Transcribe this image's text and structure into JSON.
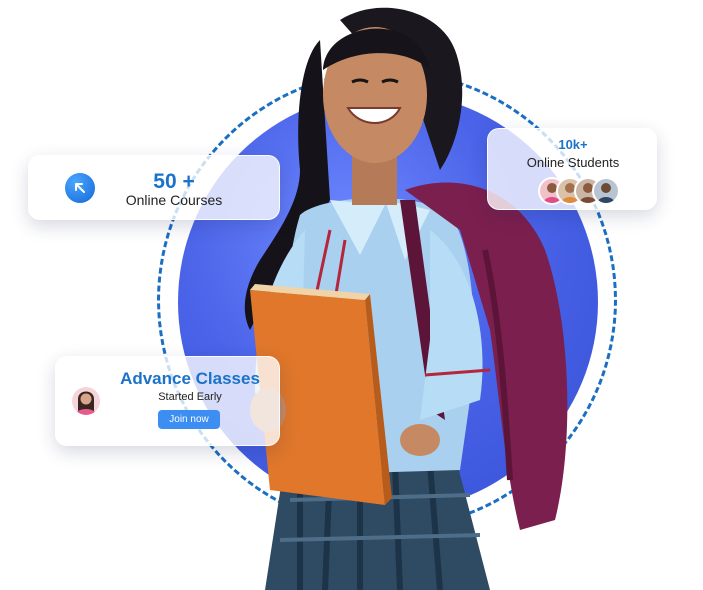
{
  "stats": {
    "courses": {
      "count": "50 +",
      "label": "Online Courses",
      "icon": "arrow-up-left-icon"
    },
    "students": {
      "count": "10k+",
      "label": "Online Students"
    }
  },
  "classes": {
    "title": "Advance Classes",
    "subtitle": "Started Early",
    "button_label": "Join now"
  },
  "colors": {
    "accent": "#1b73c9",
    "ring": "#1a6fc4",
    "disc": "#4a63e8",
    "button": "#3d8ef2"
  }
}
